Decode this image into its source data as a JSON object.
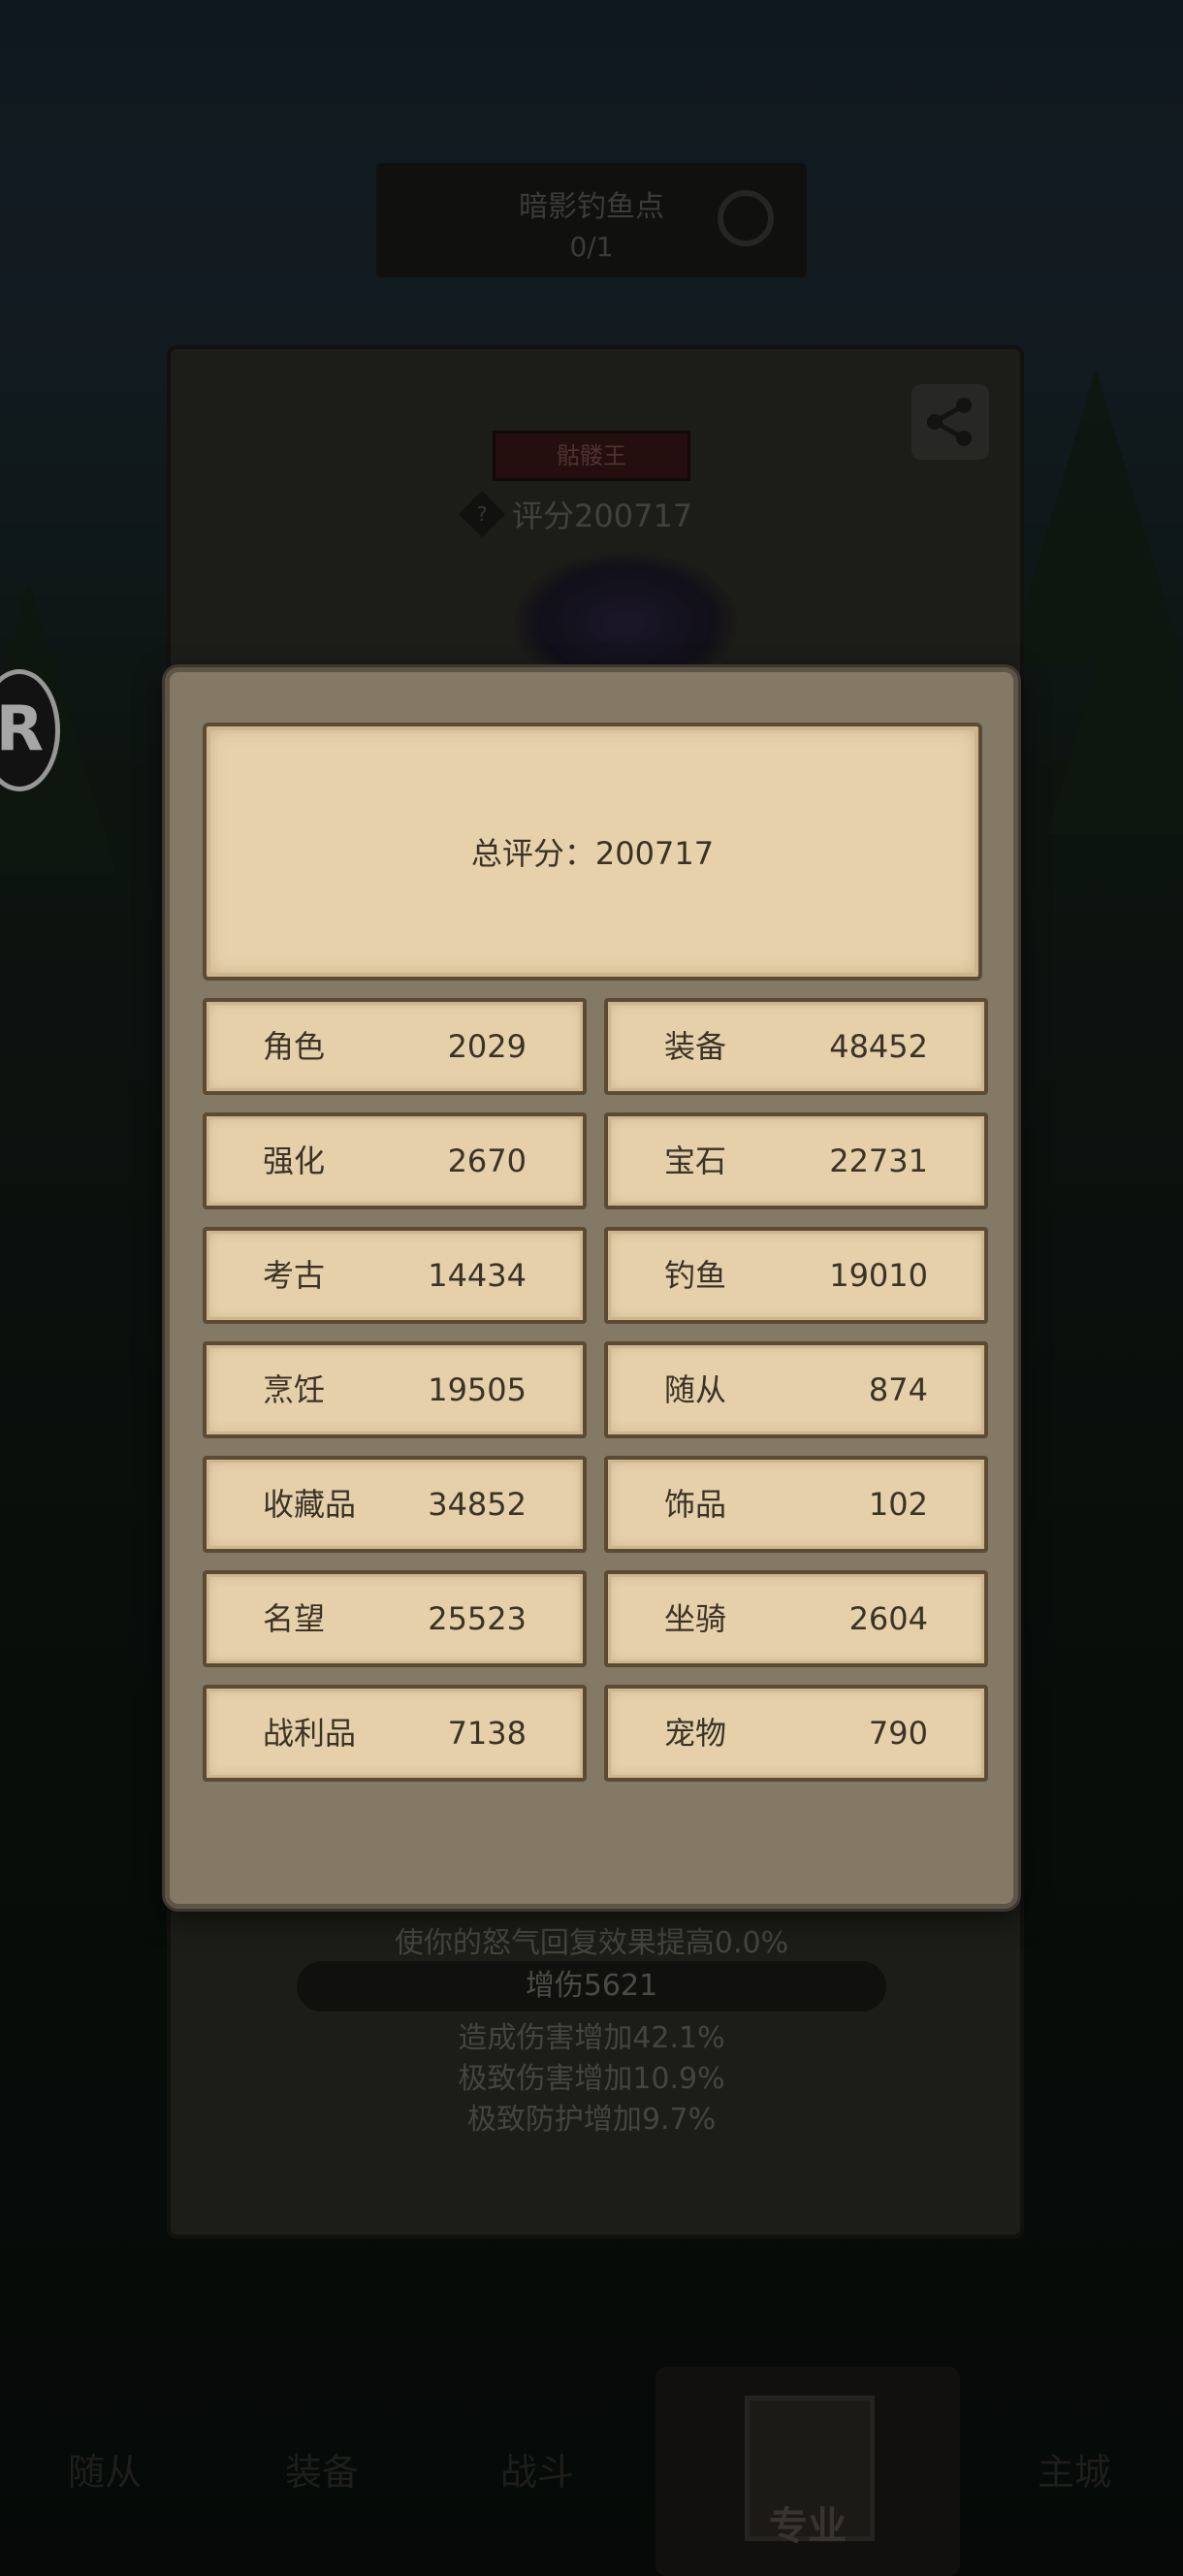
{
  "background": {
    "fishing_spot": {
      "title": "暗影钓鱼点",
      "count": "0/1"
    },
    "boss_tag": "骷髅王",
    "score_label": "评分200717",
    "help_icon": "?",
    "badge_letter": "R",
    "buff_text": "使你的怒气回复效果提高0.0%",
    "damage_pill": "增伤5621",
    "effects": [
      "造成伤害增加42.1%",
      "极致伤害增加10.9%",
      "极致防护增加9.7%"
    ],
    "nav": [
      {
        "label": "随从"
      },
      {
        "label": "装备"
      },
      {
        "label": "战斗"
      },
      {
        "label": "专业"
      },
      {
        "label": "主城"
      }
    ]
  },
  "popup": {
    "total_label": "总评分：200717",
    "stats": [
      {
        "name": "角色",
        "value": "2029"
      },
      {
        "name": "装备",
        "value": "48452"
      },
      {
        "name": "强化",
        "value": "2670"
      },
      {
        "name": "宝石",
        "value": "22731"
      },
      {
        "name": "考古",
        "value": "14434"
      },
      {
        "name": "钓鱼",
        "value": "19010"
      },
      {
        "name": "烹饪",
        "value": "19505"
      },
      {
        "name": "随从",
        "value": "874"
      },
      {
        "name": "收藏品",
        "value": "34852"
      },
      {
        "name": "饰品",
        "value": "102"
      },
      {
        "name": "名望",
        "value": "25523"
      },
      {
        "name": "坐骑",
        "value": "2604"
      },
      {
        "name": "战利品",
        "value": "7138"
      },
      {
        "name": "宠物",
        "value": "790"
      }
    ]
  },
  "colors": {
    "card": "#e5d0aa",
    "card_border": "#5b4b34",
    "popup_bg": "#837964",
    "text": "#3b3328"
  }
}
